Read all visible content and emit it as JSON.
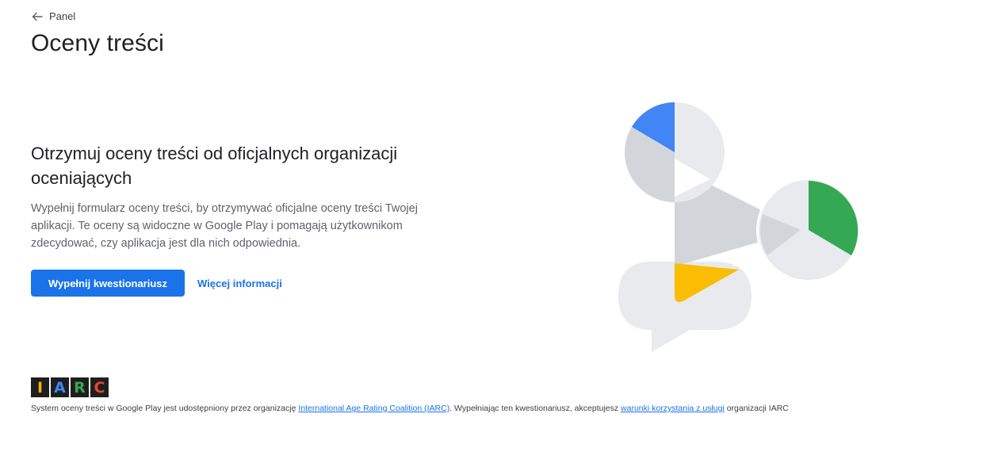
{
  "nav": {
    "back_label": "Panel"
  },
  "page": {
    "title": "Oceny treści"
  },
  "hero": {
    "heading": "Otrzymuj oceny treści od oficjalnych organizacji oceniających",
    "description": "Wypełnij formularz oceny treści, by otrzymywać oficjalne oceny treści Twojej aplikacji. Te oceny są widoczne w Google Play i pomagają użytkownikom zdecydować, czy aplikacja jest dla nich odpowiednia.",
    "primary_button_label": "Wypełnij kwestionariusz",
    "more_info_label": "Więcej informacji"
  },
  "footer": {
    "logo_letters": {
      "i": "I",
      "a": "A",
      "r": "R",
      "c": "C"
    },
    "logo_colors": {
      "i": "#f4b400",
      "a": "#4285f4",
      "r": "#34a853",
      "c": "#ea4335"
    },
    "text_before": "System oceny treści w Google Play jest udostępniony przez organizację ",
    "iarc_link": "International Age Rating Coalition (IARC)",
    "text_middle": ". Wypełniając ten kwestionariusz, akceptujesz ",
    "terms_link": "warunki korzystania z usługi",
    "text_after": " organizacji IARC"
  },
  "colors": {
    "accent": "#1a73e8",
    "illustration_blue": "#4285f4",
    "illustration_green": "#34a853",
    "illustration_yellow": "#fbbc04",
    "illustration_light": "#e8eaed",
    "illustration_mid": "#d2d6da"
  },
  "icons": {
    "back": "arrow-left-icon"
  }
}
